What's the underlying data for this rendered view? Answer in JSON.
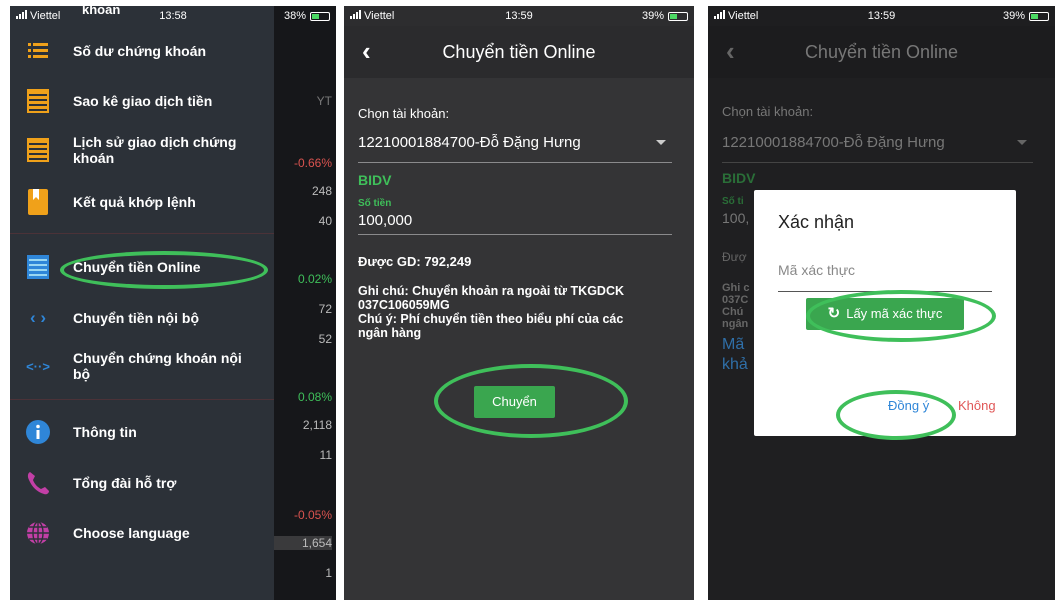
{
  "colors": {
    "accent_green": "#3fbf5a",
    "button_green": "#3aa64f",
    "cancel_red": "#e05757",
    "confirm_blue": "#2f86d8"
  },
  "status": [
    {
      "carrier": "Viettel",
      "time": "13:58",
      "battery": "38%"
    },
    {
      "carrier": "Viettel",
      "time": "13:59",
      "battery": "39%"
    },
    {
      "carrier": "Viettel",
      "time": "13:59",
      "battery": "39%"
    }
  ],
  "drawer": {
    "cut_top_text": "khoản",
    "items": [
      {
        "label": "Số dư chứng khoán",
        "icon": "list-icon"
      },
      {
        "label": "Sao kê giao dịch tiền",
        "icon": "statement-icon"
      },
      {
        "label": "Lịch sử giao dịch chứng khoán",
        "icon": "history-icon"
      },
      {
        "label": "Kết quả khớp lệnh",
        "icon": "bookmark-icon"
      },
      {
        "label": "Chuyển tiền Online",
        "icon": "transfer-online-icon"
      },
      {
        "label": "Chuyển tiền nội bộ",
        "icon": "code-arrows-icon"
      },
      {
        "label": "Chuyển chứng khoán nội bộ",
        "icon": "code-dots-icon"
      },
      {
        "label": "Thông tin",
        "icon": "info-icon"
      },
      {
        "label": "Tổng đài hỗ trợ",
        "icon": "phone-icon"
      },
      {
        "label": "Choose language",
        "icon": "globe-icon"
      }
    ],
    "background_values": [
      "YT",
      "-0.66%",
      "248",
      "40",
      "0.02%",
      "72",
      "52",
      "0.08%",
      "2,118",
      "11",
      "-0.05%",
      "1,654",
      "1"
    ]
  },
  "transfer": {
    "title": "Chuyển tiền Online",
    "account_label": "Chọn tài khoản:",
    "account_value": "12210001884700-Đỗ Đặng Hưng",
    "bank": "BIDV",
    "amount_label": "Số tiền",
    "amount_value": "100,000",
    "available": "Được GD: 792,249",
    "note_line1": "Ghi chú: Chuyển khoản ra ngoài  từ TKGDCK",
    "note_line2": "037C106059MG",
    "note_line3": "Chú ý: Phí chuyển tiền theo biểu phí của các",
    "note_line4": "ngân hàng",
    "submit_label": "Chuyển"
  },
  "dialog": {
    "title": "Xác nhận",
    "code_placeholder": "Mã xác thực",
    "get_code_label": "Lấy mã xác thực",
    "confirm_label": "Đồng ý",
    "cancel_label": "Không",
    "bg_peek": [
      "Đượ",
      "Ghi c",
      "037C",
      "Chú",
      "ngân",
      "Mã",
      "khả",
      "Số ti",
      "100,"
    ]
  }
}
